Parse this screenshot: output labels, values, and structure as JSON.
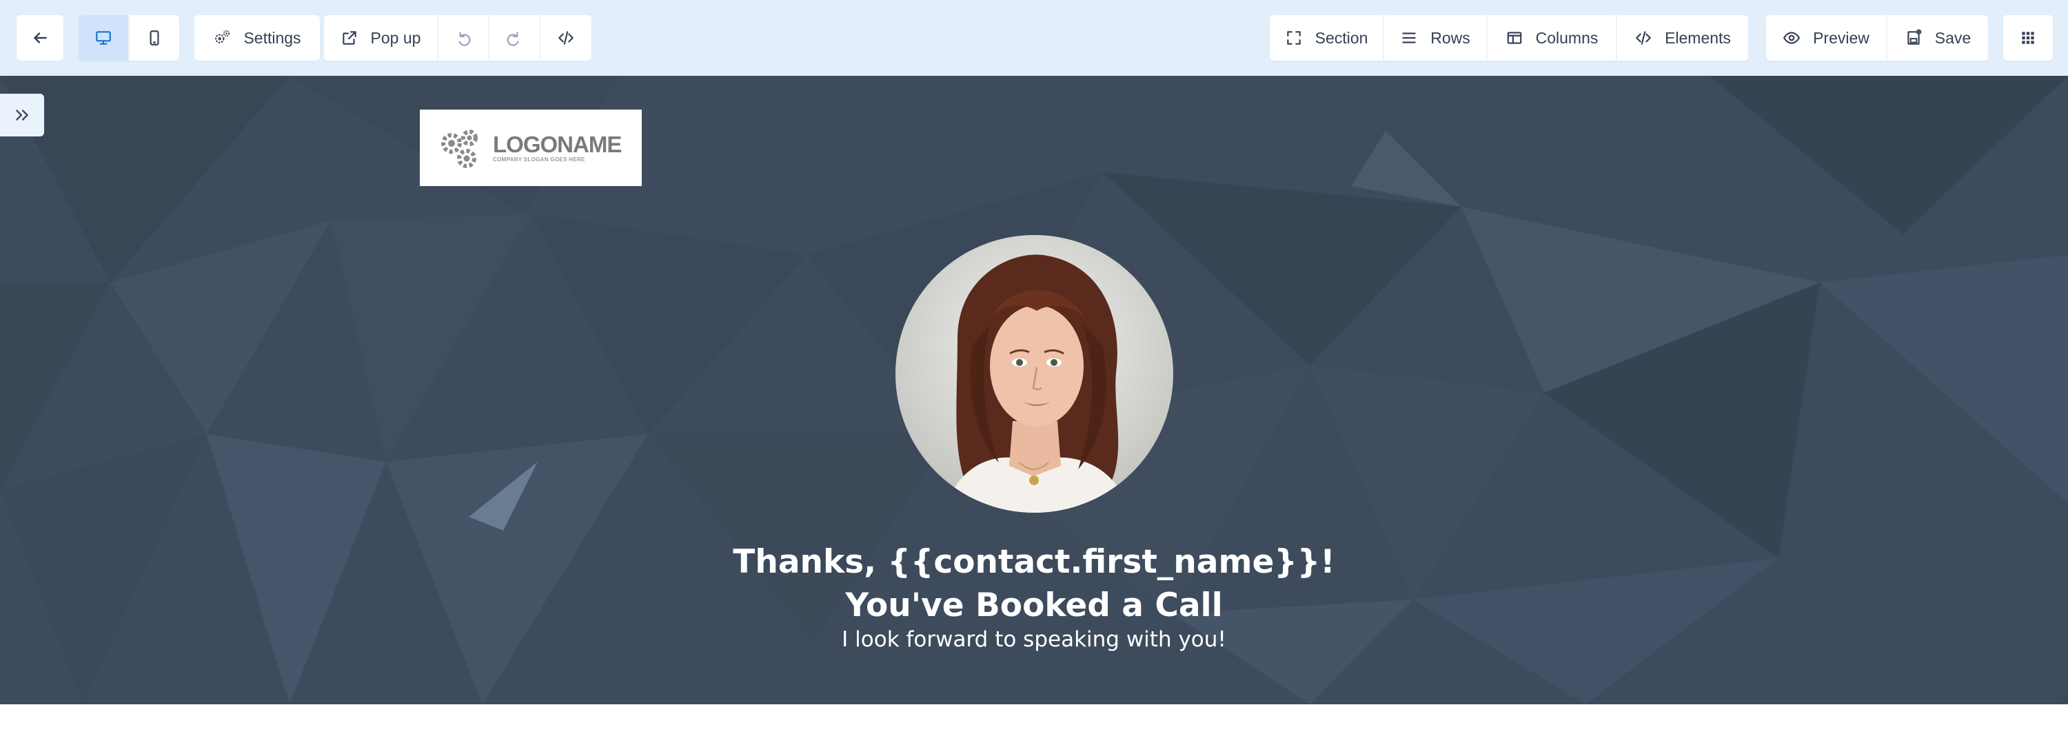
{
  "toolbar": {
    "settings_label": "Settings",
    "popup_label": "Pop up",
    "section_label": "Section",
    "rows_label": "Rows",
    "columns_label": "Columns",
    "elements_label": "Elements",
    "preview_label": "Preview",
    "save_label": "Save",
    "active_device": "desktop"
  },
  "page": {
    "logo_name": "LOGONAME",
    "logo_slogan": "COMPANY SLOGAN GOES HERE",
    "headline_line1": "Thanks, {{contact.first_name}}!",
    "headline_line2": "You've Booked a Call",
    "subheadline": "I look forward to speaking with you!"
  },
  "colors": {
    "toolbar_bg": "#e3eefb",
    "accent": "#1d6fd1",
    "hero_bg": "#3c4a5b",
    "text_on_dark": "#ffffff"
  }
}
